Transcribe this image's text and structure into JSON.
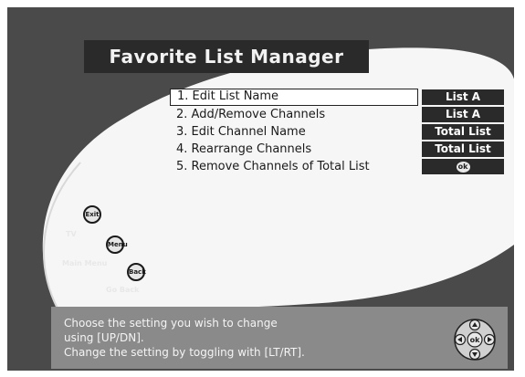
{
  "title": "Favorite List Manager",
  "menu": [
    {
      "label": "1. Edit List Name",
      "value": "List A",
      "selected": true
    },
    {
      "label": "2. Add/Remove Channels",
      "value": "List A",
      "selected": false
    },
    {
      "label": "3. Edit Channel Name",
      "value": "Total List",
      "selected": false
    },
    {
      "label": "4. Rearrange Channels",
      "value": "Total List",
      "selected": false
    },
    {
      "label": "5. Remove Channels of Total List",
      "value": "ok",
      "selected": false
    }
  ],
  "side_buttons": {
    "exit": {
      "button_text": "Exit",
      "label": "TV"
    },
    "menu": {
      "button_text": "Menu",
      "label": "Main Menu"
    },
    "back": {
      "button_text": "Back",
      "label": "Go Back"
    }
  },
  "help": {
    "line1": "Choose the setting you wish to change",
    "line2": "using [UP/DN].",
    "line3": "Change the setting by toggling with [LT/RT]."
  },
  "dpad_center": "ok",
  "colors": {
    "frame": "#4a4a4a",
    "panel_dark": "#2a2a2a",
    "help_box": "#8a8a8a",
    "menu_background": "#ffffff"
  },
  "icons": {
    "dpad": "directional-pad-icon",
    "ok": "ok-button-icon"
  }
}
